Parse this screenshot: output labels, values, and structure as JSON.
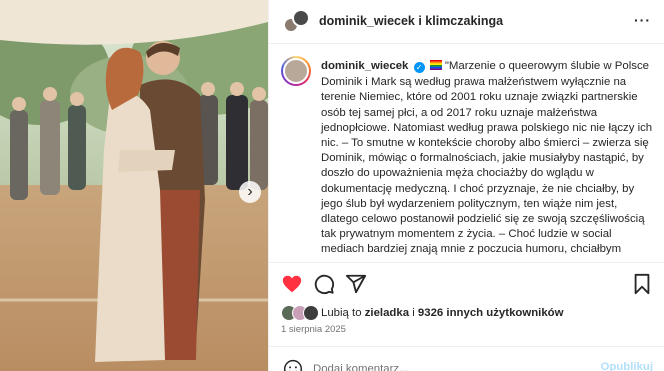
{
  "photo": {
    "alt_name": "wedding-photo",
    "next_arrow": "›"
  },
  "header": {
    "title": "dominik_wiecek i klimczakinga",
    "more": "···"
  },
  "caption": {
    "username": "dominik_wiecek",
    "text": "\"Marzenie o queerowym ślubie w Polsce Dominik i Mark są według prawa małżeństwem wyłącznie na terenie Niemiec, które od 2001 roku uznaje związki partnerskie osób tej samej płci, a od 2017 roku uznaje małżeństwa jednopłciowe. Natomiast według prawa polskiego nic nie łączy ich nic. – To smutne w kontekście choroby albo śmierci – zwierza się Dominik, mówiąc o formalnościach, jakie musiałyby nastąpić, by doszło do upoważnienia męża chociażby do wglądu w dokumentację medyczną. I choć przyznaje, że nie chciałby, by jego ślub był wydarzeniem politycznym, ten wiąże nim jest, dlatego celowo postanowił podzielić się ze swoją szczęśliwością tak prywatnym momentem z życia. – Choć ludzie w social mediach bardziej znają mnie z poczucia humoru, chciałbym stworzyć bezpieczną przestrzeń do rozmowy o związkach"
  },
  "likes": {
    "prefix": "Lubią to ",
    "user": "zieladka",
    "middle": " i ",
    "count_text": "9326 innych użytkowników"
  },
  "date": "1 sierpnia 2025",
  "comment": {
    "placeholder": "Dodaj komentarz...",
    "post_label": "Opublikuj"
  },
  "colors": {
    "like_red": "#ff3040",
    "verified_blue": "#0095f6",
    "post_disabled": "#b2dffc"
  },
  "icons": {
    "like": "heart-icon",
    "comment": "comment-icon",
    "share": "share-icon",
    "save": "bookmark-icon",
    "emoji": "emoji-icon",
    "more": "more-icon",
    "verified": "verified-icon",
    "next": "chevron-right-icon"
  }
}
